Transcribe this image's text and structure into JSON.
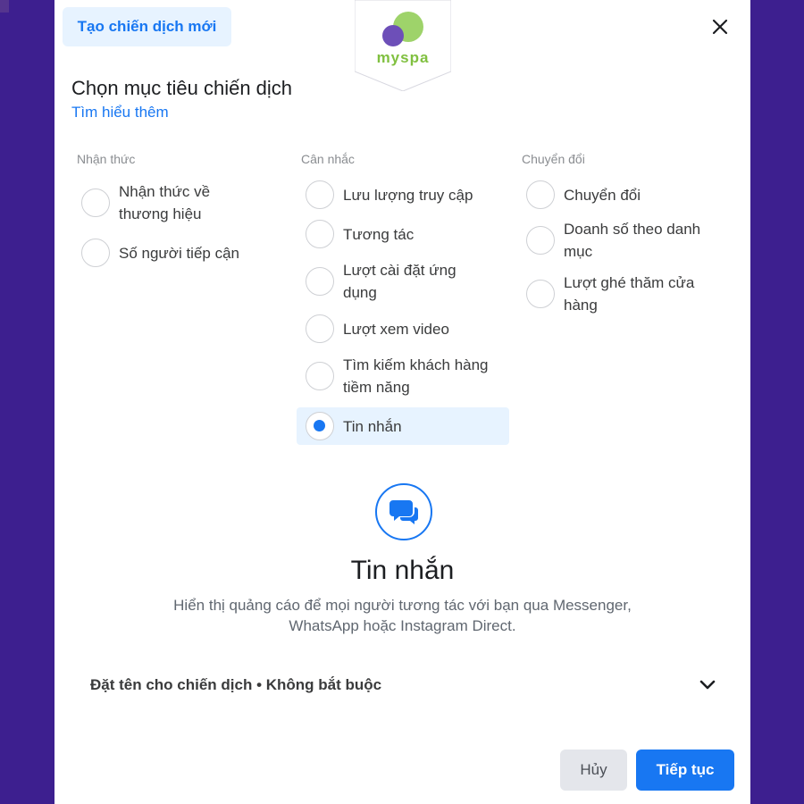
{
  "header": {
    "tab_label": "Tạo chiến dịch mới",
    "logo_text": "myspa",
    "close_icon": "close-icon"
  },
  "heading": {
    "title": "Chọn mục tiêu chiến dịch",
    "learn_more": "Tìm hiểu thêm"
  },
  "columns": [
    {
      "title": "Nhận thức",
      "options": [
        {
          "label": "Nhận thức về thương hiệu",
          "selected": false
        },
        {
          "label": "Số người tiếp cận",
          "selected": false
        }
      ]
    },
    {
      "title": "Cân nhắc",
      "options": [
        {
          "label": "Lưu lượng truy cập",
          "selected": false
        },
        {
          "label": "Tương tác",
          "selected": false
        },
        {
          "label": "Lượt cài đặt ứng dụng",
          "selected": false
        },
        {
          "label": "Lượt xem video",
          "selected": false
        },
        {
          "label": "Tìm kiếm khách hàng tiềm năng",
          "selected": false
        },
        {
          "label": "Tin nhắn",
          "selected": true
        }
      ]
    },
    {
      "title": "Chuyển đổi",
      "options": [
        {
          "label": "Chuyển đổi",
          "selected": false
        },
        {
          "label": "Doanh số theo danh mục",
          "selected": false
        },
        {
          "label": "Lượt ghé thăm cửa hàng",
          "selected": false
        }
      ]
    }
  ],
  "detail": {
    "icon": "messages-icon",
    "title": "Tin nhắn",
    "description": "Hiển thị quảng cáo để mọi người tương tác với bạn qua Messenger, WhatsApp hoặc Instagram Direct."
  },
  "campaign_name": {
    "label": "Đặt tên cho chiến dịch • Không bắt buộc",
    "icon": "chevron-down-icon"
  },
  "footer": {
    "cancel_label": "Hủy",
    "next_label": "Tiếp tục"
  },
  "colors": {
    "accent": "#1877f2",
    "background": "#3d1f8f",
    "selected_bg": "#e7f3ff"
  }
}
